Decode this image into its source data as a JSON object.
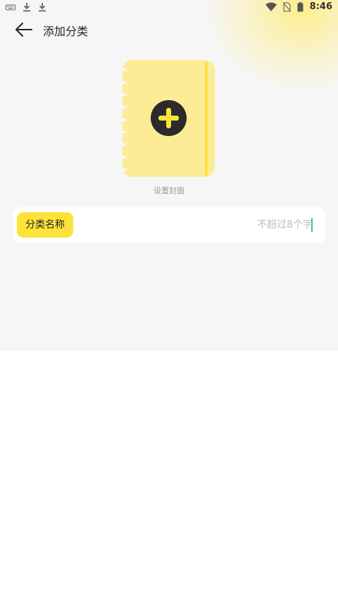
{
  "status_bar": {
    "time": "8:46",
    "icons": [
      "keyboard-icon",
      "download-icon",
      "download-icon",
      "wifi-icon",
      "no-sim-icon",
      "battery-icon"
    ]
  },
  "header": {
    "title": "添加分类",
    "back_icon": "back-arrow-icon"
  },
  "cover": {
    "label": "设置封面",
    "icon": "plus-circle-icon",
    "colors": {
      "cover": "#fdec96",
      "accent": "#fde23a",
      "circle": "#2b2b2b"
    }
  },
  "name_field": {
    "label": "分类名称",
    "value": "",
    "placeholder": "不超过8个字"
  },
  "colors": {
    "background": "#f6f6f6",
    "accent": "#fde23a",
    "caret": "#2bc5b4"
  }
}
